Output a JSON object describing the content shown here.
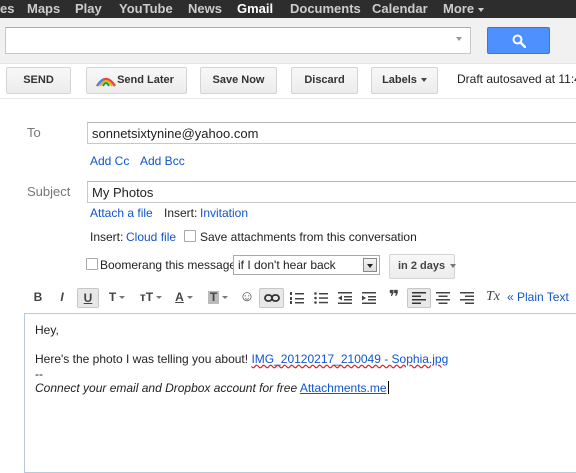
{
  "nav": {
    "items": [
      "es",
      "Maps",
      "Play",
      "YouTube",
      "News",
      "Gmail",
      "Documents",
      "Calendar",
      "More"
    ]
  },
  "search": {
    "value": "",
    "placeholder": ""
  },
  "actions": {
    "send": "SEND",
    "send_later": "Send Later",
    "save_now": "Save Now",
    "discard": "Discard",
    "labels": "Labels",
    "autosave": "Draft autosaved at 11:4"
  },
  "compose": {
    "to_label": "To",
    "to_value": "sonnetsixtynine@yahoo.com",
    "add_cc": "Add Cc",
    "add_bcc": "Add Bcc",
    "subject_label": "Subject",
    "subject_value": "My Photos",
    "attach_file": "Attach a file",
    "insert_label": "Insert:",
    "invitation": "Invitation",
    "insert_label2": "Insert:",
    "cloud_file": "Cloud file",
    "save_attachments": "Save attachments from this conversation",
    "boomerang": "Boomerang this message",
    "boomerang_option": "if I don't hear back",
    "boomerang_days": "in 2 days"
  },
  "toolbar": {
    "bold": "B",
    "italic": "I",
    "underline": "U",
    "font": "T",
    "size": "тT",
    "text_color": "A",
    "highlight": "T",
    "emoji": "☺",
    "quote": "❞",
    "clear_format": "Tx",
    "plain_text": "« Plain Text"
  },
  "body": {
    "greeting": "Hey,",
    "line2": "Here's the photo I was telling you about!",
    "file_link": "IMG_20120217_210049 - Sophia.jpg",
    "separator": "--",
    "signature": "Connect your email and Dropbox account for free",
    "sig_link": "Attachments.me"
  },
  "colors": {
    "accent_blue": "#4d90fe",
    "link_blue": "#1155cc",
    "topbar": "#2d2d2d"
  }
}
